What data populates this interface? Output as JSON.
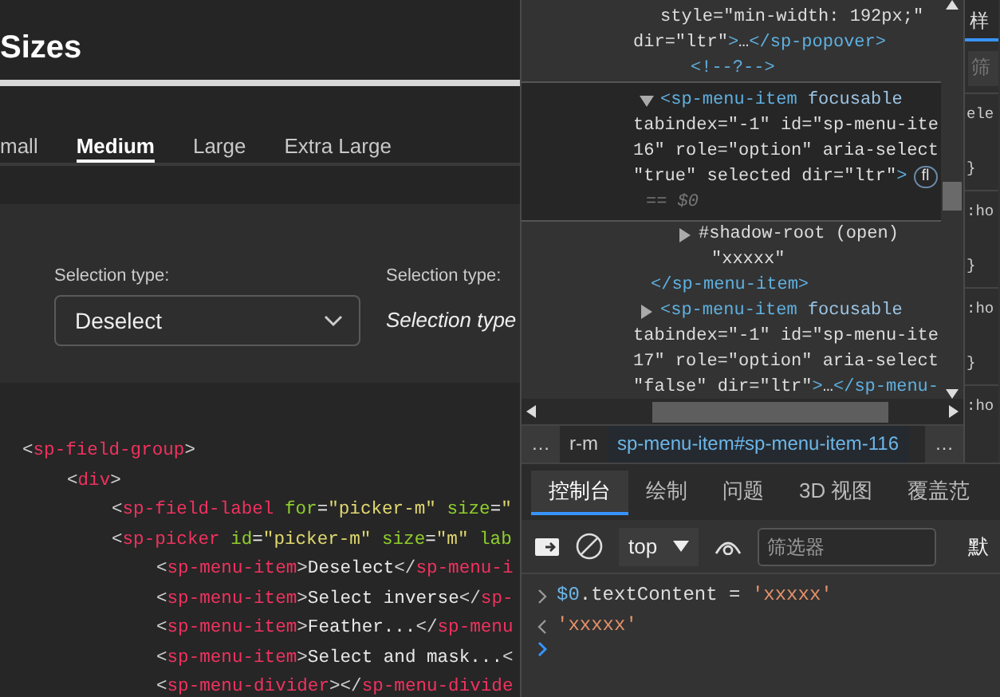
{
  "page": {
    "title": "Sizes",
    "tabs": [
      {
        "label": "mall",
        "selected": false
      },
      {
        "label": "Medium",
        "selected": true
      },
      {
        "label": "Large",
        "selected": false
      },
      {
        "label": "Extra Large",
        "selected": false
      }
    ],
    "fields": [
      {
        "kind": "picker",
        "label": "Selection type:",
        "value": "Deselect"
      },
      {
        "kind": "quiet",
        "label": "Selection type:",
        "value": "Selection type"
      }
    ],
    "code": [
      {
        "text": "<sp-field-group>",
        "children": [
          {
            "text": "<div>",
            "children": [
              {
                "text": "<sp-field-label for=\"picker-m\" size=\""
              },
              {
                "text": "<sp-picker id=\"picker-m\" size=\"m\" lab",
                "children": [
                  {
                    "text": "<sp-menu-item>Deselect</sp-menu-i"
                  },
                  {
                    "text": "<sp-menu-item>Select inverse</sp-"
                  },
                  {
                    "text": "<sp-menu-item>Feather...</sp-menu"
                  },
                  {
                    "text": "<sp-menu-item>Select and mask...<"
                  },
                  {
                    "text": "<sp-menu-divider></sp-menu-divide"
                  }
                ]
              }
            ]
          }
        ]
      }
    ]
  },
  "elements": [
    {
      "kind": "element",
      "lines": [
        "style=\"min-width: 192px;\"",
        "dir=\"ltr\">…</sp-popover>"
      ]
    },
    {
      "kind": "comment",
      "lines": [
        "<!--?-->"
      ]
    },
    {
      "kind": "element",
      "lines": [
        "<sp-menu-item focusable",
        "tabindex=\"-1\" id=\"sp-menu-ite",
        "16\" role=\"option\" aria-select",
        "\"true\" selected dir=\"ltr\">"
      ],
      "badge": "fl",
      "marker": "== $0",
      "selected": true,
      "expanded": true,
      "children": [
        {
          "kind": "shadow",
          "lines": [
            "#shadow-root (open)"
          ],
          "expanded": false
        },
        {
          "kind": "text",
          "lines": [
            "\"xxxxx\""
          ]
        }
      ],
      "closing": "</sp-menu-item>"
    },
    {
      "kind": "element",
      "lines": [
        "<sp-menu-item focusable",
        "tabindex=\"-1\" id=\"sp-menu-ite",
        "17\" role=\"option\" aria-select",
        "\"false\" dir=\"ltr\">…</sp-menu-"
      ],
      "selected": false,
      "expanded": false
    }
  ],
  "breadcrumbs": [
    {
      "kind": "more",
      "label": "…",
      "selected": false
    },
    {
      "kind": "crumb",
      "label": "r-m",
      "selected": false
    },
    {
      "kind": "crumb",
      "label": "sp-menu-item#sp-menu-item-116",
      "selected": true
    },
    {
      "kind": "more",
      "label": "…",
      "selected": false
    }
  ],
  "styles": {
    "tab": "样",
    "filter_placeholder": "筛",
    "rules": [
      [
        "ele",
        "}"
      ],
      [
        ":ho",
        "}"
      ],
      [
        ":ho",
        "}"
      ],
      [
        ":ho"
      ]
    ]
  },
  "console": {
    "tabs": [
      {
        "label": "控制台",
        "selected": true
      },
      {
        "label": "绘制",
        "selected": false
      },
      {
        "label": "问题",
        "selected": false
      },
      {
        "label": "3D 视图",
        "selected": false
      },
      {
        "label": "覆盖范",
        "selected": false
      }
    ],
    "context": "top",
    "filter_placeholder": "筛选器",
    "levels": "默",
    "messages": [
      {
        "kind": "input",
        "text": "$0.textContent = 'xxxxx'"
      },
      {
        "kind": "result",
        "text": "'xxxxx'"
      },
      {
        "kind": "prompt"
      }
    ]
  }
}
